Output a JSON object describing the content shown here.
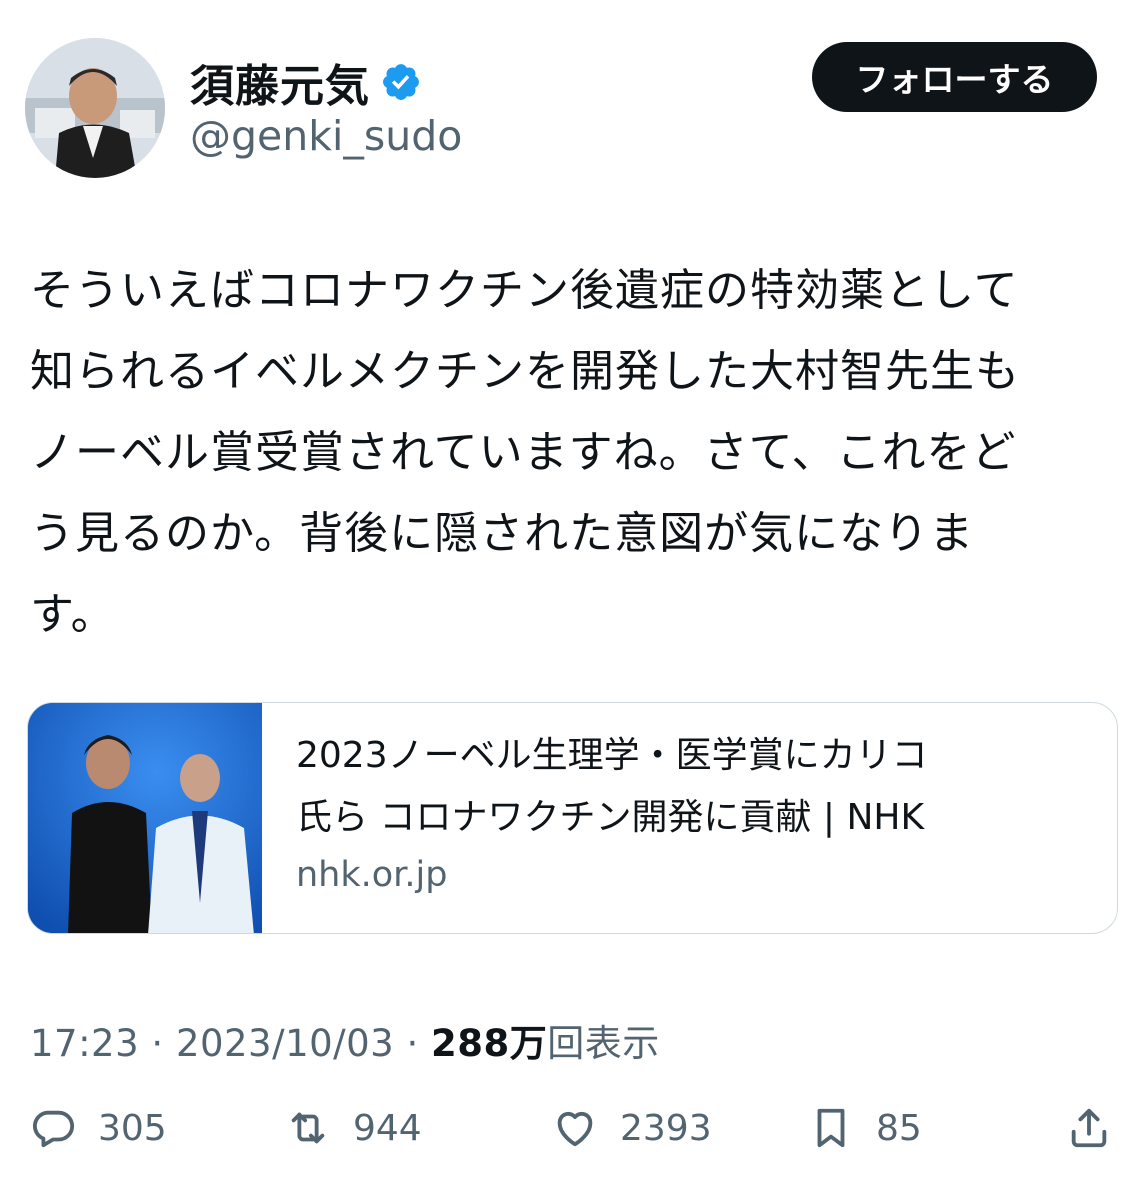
{
  "author": {
    "name": "須藤元気",
    "handle": "@genki_sudo",
    "verified": true,
    "verified_color": "#1d9bf0"
  },
  "follow_button": {
    "label": "フォローする"
  },
  "tweet": {
    "text": "そういえばコロナワクチン後遺症の特効薬として\n知られるイベルメクチンを開発した大村智先生も\nノーベル賞受賞されていますね。さて、これをど\nう見るのか。背後に隠された意図が気になりま\nす。"
  },
  "link_card": {
    "title": "2023ノーベル生理学・医学賞にカリコ\n氏ら コロナワクチン開発に貢献 | NHK",
    "domain": "nhk.or.jp",
    "image_icon": "nobel-laureates-photo"
  },
  "meta": {
    "time": "17:23",
    "separator": " · ",
    "date": "2023/10/03",
    "views_number": "288万",
    "views_label": "回表示"
  },
  "actions": {
    "replies": "305",
    "retweets": "944",
    "likes": "2393",
    "bookmarks": "85"
  },
  "colors": {
    "text": "#0f1419",
    "secondary": "#536471",
    "border": "#cfd9de"
  }
}
